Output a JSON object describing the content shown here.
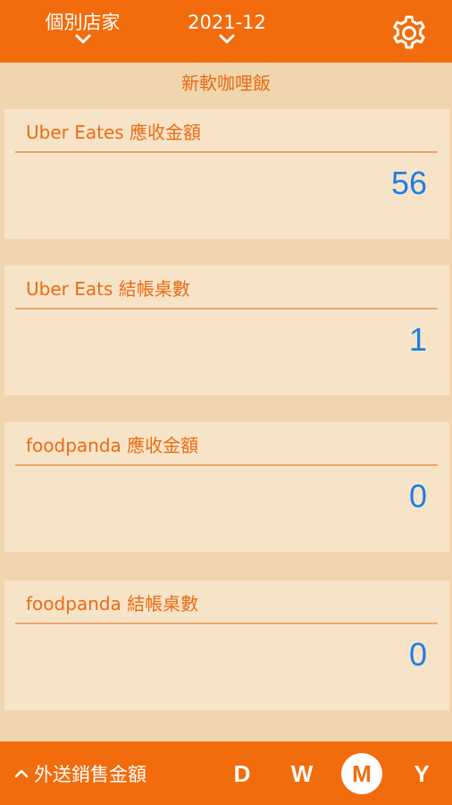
{
  "header": {
    "store_label": "個別店家",
    "period_label": "2021-12",
    "settings_icon": "gear-icon"
  },
  "subtitle": "新軟咖哩飯",
  "cards": [
    {
      "title": "Uber Eates 應收金額",
      "value": "56"
    },
    {
      "title": "Uber Eats 結帳桌數",
      "value": "1"
    },
    {
      "title": "foodpanda 應收金額",
      "value": "0"
    },
    {
      "title": "foodpanda 結帳桌數",
      "value": "0"
    }
  ],
  "footer": {
    "report_label": "外送銷售金額",
    "periods": [
      "D",
      "W",
      "M",
      "Y"
    ],
    "active_period": "M"
  },
  "colors": {
    "primary": "#f26c0d",
    "background": "#f0d6ae",
    "card": "#f7e4c8",
    "value": "#1e7fe3"
  }
}
